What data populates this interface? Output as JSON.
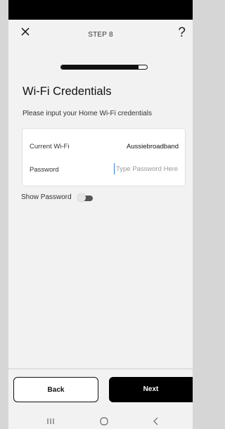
{
  "header": {
    "step_label": "STEP 8",
    "help_label": "?"
  },
  "icons": {
    "close": "close-icon",
    "toggle": "toggle-icon",
    "recents": "recent-apps-icon",
    "home": "home-icon",
    "back": "back-icon"
  },
  "progress": {
    "fraction": 0.9
  },
  "page": {
    "title": "Wi-Fi Credentials",
    "subtitle": "Please input your Home Wi-Fi credentials"
  },
  "form": {
    "current_wifi_label": "Current Wi-Fi",
    "current_wifi_value": "Aussiebroadband",
    "password_label": "Password",
    "password_placeholder": "Type Password Here",
    "password_value": ""
  },
  "show_password": {
    "label": "Show Password",
    "enabled": false
  },
  "footer": {
    "back_label": "Back",
    "next_label": "Next"
  },
  "colors": {
    "accent": "#000000",
    "background": "#f2f2f2",
    "card": "#ffffff",
    "cursor": "#2f7fd0"
  }
}
